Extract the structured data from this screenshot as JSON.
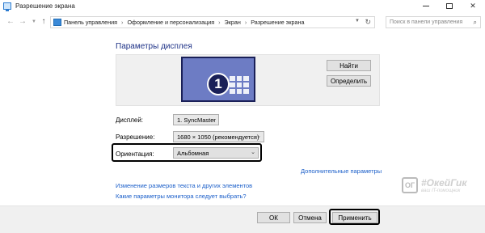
{
  "window": {
    "title": "Разрешение экрана",
    "minimize_icon": "minimize-icon",
    "maximize_icon": "maximize-icon",
    "close_icon": "close-icon"
  },
  "nav": {
    "breadcrumb": [
      "Панель управления",
      "Оформление и персонализация",
      "Экран",
      "Разрешение экрана"
    ],
    "separator": "›",
    "search_placeholder": "Поиск в панели управления"
  },
  "main": {
    "heading": "Параметры дисплея",
    "monitor_number": "1",
    "find_button": "Найти",
    "identify_button": "Определить",
    "display_label": "Дисплей:",
    "display_value": "1. SyncMaster",
    "resolution_label": "Разрешение:",
    "resolution_value": "1680 × 1050 (рекомендуется)",
    "orientation_label": "Ориентация:",
    "orientation_value": "Альбомная",
    "advanced_link": "Дополнительные параметры",
    "text_size_link": "Изменение размеров текста и других элементов",
    "help_link": "Какие параметры монитора следует выбрать?"
  },
  "footer": {
    "ok": "ОК",
    "cancel": "Отмена",
    "apply": "Применить"
  },
  "watermark": {
    "logo_text": "ОГ",
    "name": "#ОкейГик",
    "sub": "ваш IT-помощник"
  },
  "colors": {
    "heading": "#1e3287",
    "link": "#1a5ec9",
    "monitor_fill": "#6d7cc4",
    "monitor_border": "#1a2058"
  }
}
